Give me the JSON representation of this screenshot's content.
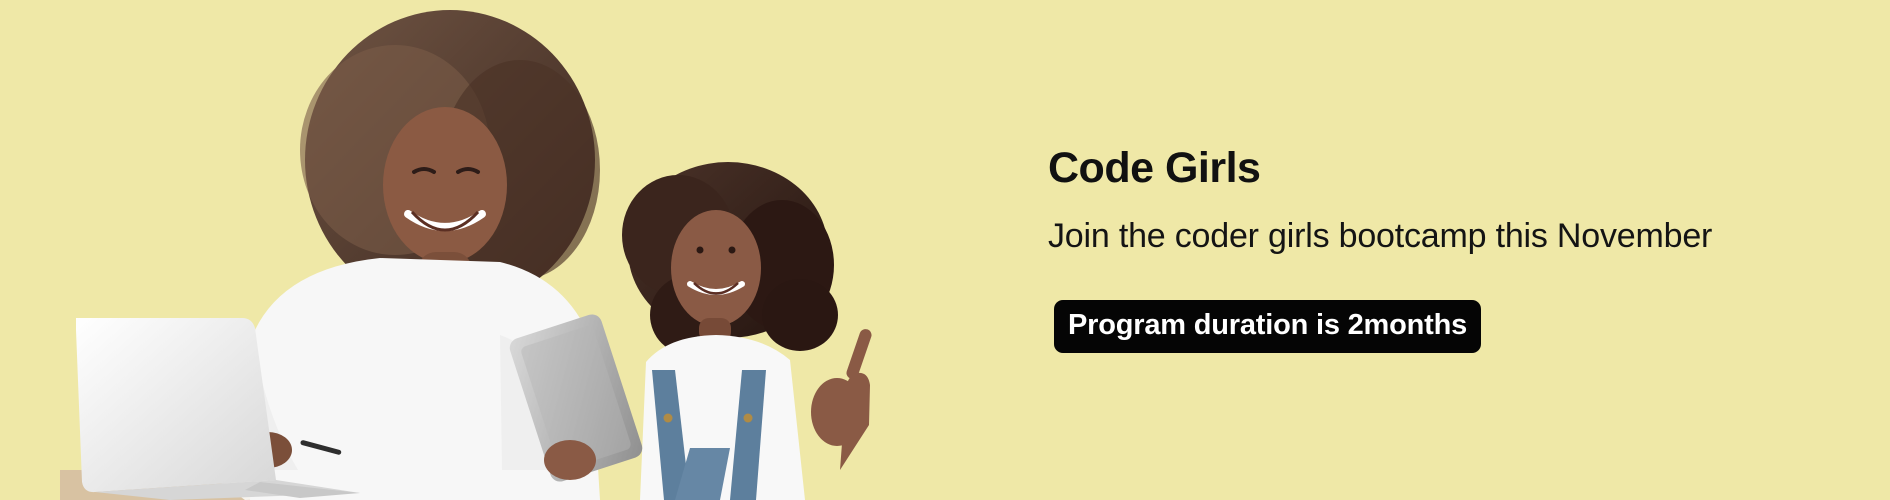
{
  "banner": {
    "title": "Code Girls",
    "subtitle": "Join the coder girls bootcamp this November",
    "badge": "Program duration is 2months"
  },
  "colors": {
    "background": "#efe8a7",
    "text_dark": "#111111",
    "badge_background": "#050505",
    "badge_text": "#ffffff"
  },
  "illustration": {
    "icon": "woman-and-girl-with-laptop-and-tablet-image"
  }
}
